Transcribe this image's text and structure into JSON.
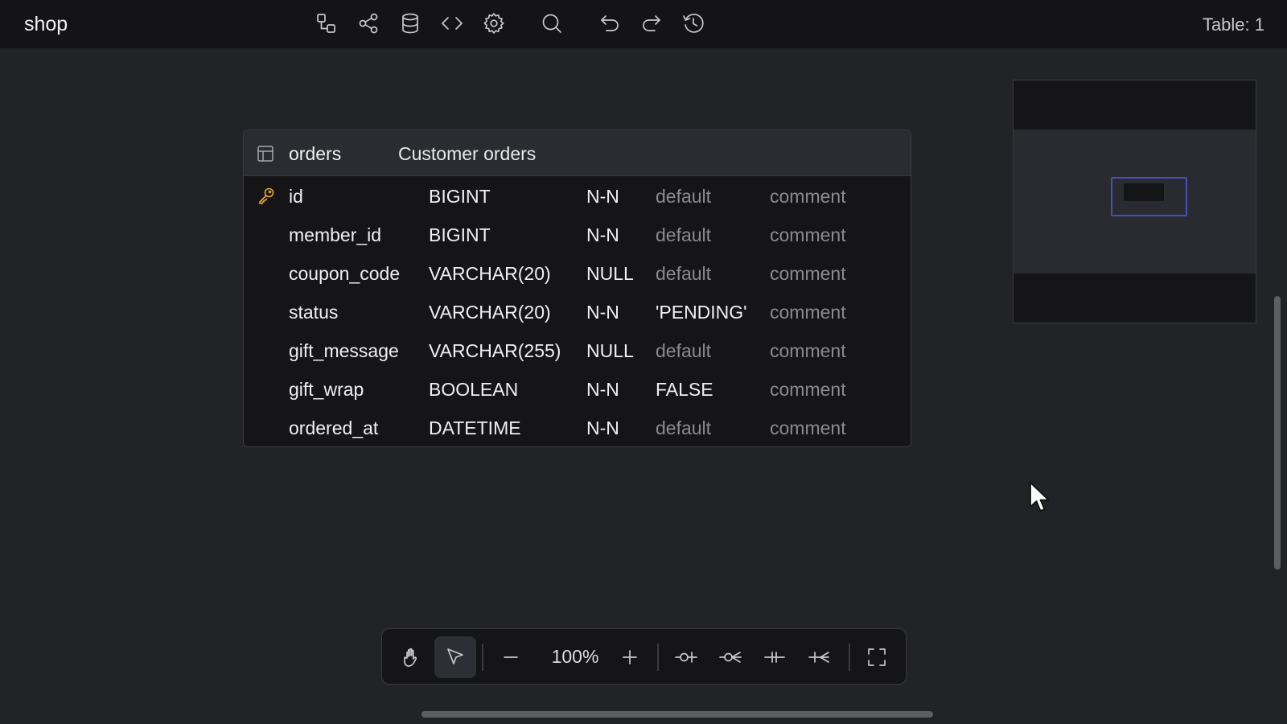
{
  "app": {
    "title": "shop",
    "table_count": "Table: 1"
  },
  "toolbar_icons": [
    "relationship-icon",
    "share-icon",
    "database-icon",
    "code-icon",
    "gear-icon",
    "search-icon",
    "undo-icon",
    "redo-icon",
    "history-icon"
  ],
  "table": {
    "name": "orders",
    "comment": "Customer orders",
    "columns": [
      {
        "name": "id",
        "type": "BIGINT",
        "nullable": "N-N",
        "default": "default",
        "comment": "comment",
        "primary_key": true
      },
      {
        "name": "member_id",
        "type": "BIGINT",
        "nullable": "N-N",
        "default": "default",
        "comment": "comment"
      },
      {
        "name": "coupon_code",
        "type": "VARCHAR(20)",
        "nullable": "NULL",
        "default": "default",
        "comment": "comment"
      },
      {
        "name": "status",
        "type": "VARCHAR(20)",
        "nullable": "N-N",
        "default": "'PENDING'",
        "comment": "comment"
      },
      {
        "name": "gift_message",
        "type": "VARCHAR(255)",
        "nullable": "NULL",
        "default": "default",
        "comment": "comment"
      },
      {
        "name": "gift_wrap",
        "type": "BOOLEAN",
        "nullable": "N-N",
        "default": "FALSE",
        "comment": "comment"
      },
      {
        "name": "ordered_at",
        "type": "DATETIME",
        "nullable": "N-N",
        "default": "default",
        "comment": "comment"
      }
    ]
  },
  "bottom_toolbar": {
    "zoom": "100%",
    "tools": [
      "hand-icon",
      "pointer-icon",
      "zoom-out-icon",
      "zoom-in-icon",
      "zero-one-icon",
      "zero-many-icon",
      "one-one-icon",
      "one-many-icon",
      "fullscreen-icon"
    ],
    "active_tool": "pointer-icon"
  },
  "colors": {
    "background": "#222327",
    "topbar": "#141416",
    "key": "#e8a62a",
    "minimap_view": "#4253b8"
  }
}
